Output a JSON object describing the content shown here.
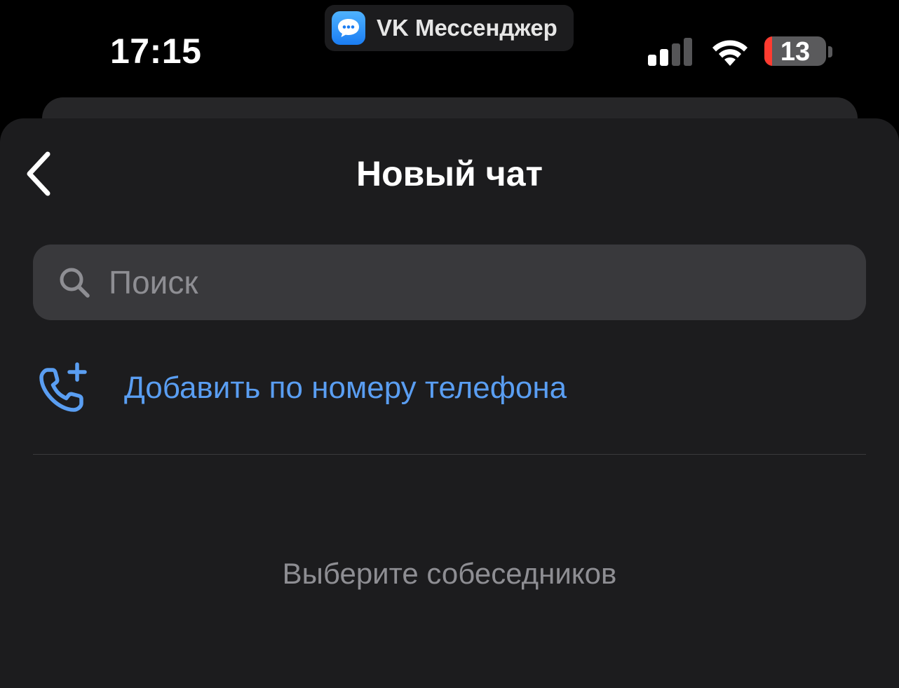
{
  "status_bar": {
    "time": "17:15",
    "app_name": "VK Мессенджер",
    "app_icon": "chat-bubble-icon",
    "battery_level": "13",
    "battery_fraction": 0.13,
    "signal_bars_active": 2,
    "signal_bars_total": 4
  },
  "nav": {
    "back_icon": "chevron-left-icon",
    "title": "Новый чат"
  },
  "search": {
    "placeholder": "Поиск",
    "value": "",
    "icon": "search-icon"
  },
  "add_by_phone": {
    "icon": "phone-add-icon",
    "label": "Добавить по номеру телефона"
  },
  "empty_state": {
    "text": "Выберите собеседников"
  },
  "colors": {
    "background": "#000000",
    "sheet": "#1c1c1e",
    "search_field": "#39393c",
    "accent": "#5a9ef2",
    "secondary_text": "#8e8e93",
    "battery_low": "#ff3b30"
  }
}
